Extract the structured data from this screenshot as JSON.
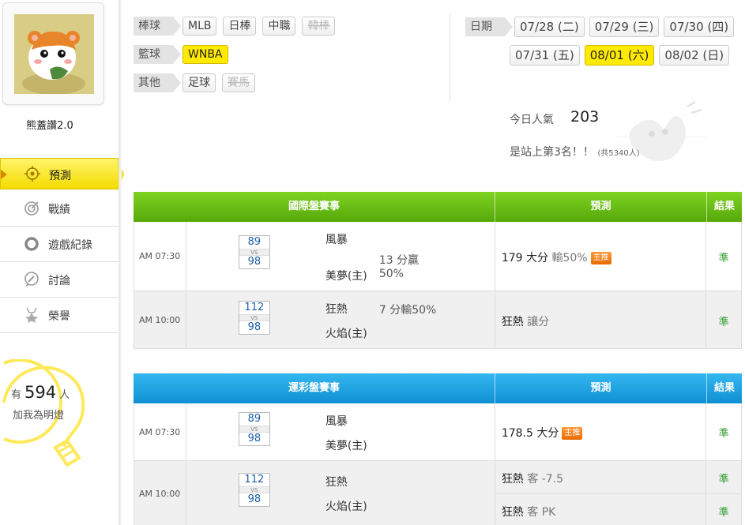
{
  "sidebar": {
    "username": "熊蓋讚2.0",
    "nav": [
      {
        "label": "預測",
        "icon": "target-icon",
        "active": true
      },
      {
        "label": "戰績",
        "icon": "record-icon",
        "active": false
      },
      {
        "label": "遊戲紀錄",
        "icon": "ring-icon",
        "active": false
      },
      {
        "label": "討論",
        "icon": "chat-icon",
        "active": false
      },
      {
        "label": "榮譽",
        "icon": "medal-icon",
        "active": false
      }
    ],
    "fans": {
      "prefix": "有",
      "count": "594",
      "suffix": "人",
      "line2": "加我為明燈"
    }
  },
  "filters": {
    "baseball": {
      "label": "棒球",
      "tags": [
        "MLB",
        "日棒",
        "中職",
        "韓棒"
      ]
    },
    "basketball": {
      "label": "籃球",
      "tags": [
        "WNBA"
      ]
    },
    "other": {
      "label": "其他",
      "tags": [
        "足球",
        "賽馬"
      ]
    },
    "dates": {
      "label": "日期",
      "row1": [
        "07/28 (二)",
        "07/29 (三)",
        "07/30 (四)"
      ],
      "row2": [
        "07/31 (五)",
        "08/01 (六)",
        "08/02 (日)"
      ]
    }
  },
  "popularity": {
    "label": "今日人氣",
    "value": "203",
    "rank": "是站上第3名！！",
    "total": "(共5340人)"
  },
  "intl": {
    "headers": [
      "國際盤賽事",
      "預測",
      "結果"
    ],
    "rows": [
      {
        "time": "AM 07:30",
        "away_score": "89",
        "home_score": "98",
        "away": "風暴",
        "home": "美夢(主)",
        "note1": "13 分贏",
        "note2": "50%",
        "pred": "179 大分",
        "pred_sub": "輸50%",
        "badge": "主推",
        "result": "準"
      },
      {
        "time": "AM 10:00",
        "away_score": "112",
        "home_score": "98",
        "away": "狂熱",
        "home": "火焰(主)",
        "note1": "7 分輸50%",
        "pred": "狂熱",
        "pred_sub": "讓分",
        "result": "準"
      }
    ]
  },
  "lottery": {
    "headers": [
      "運彩盤賽事",
      "預測",
      "結果"
    ],
    "rows": [
      {
        "time": "AM 07:30",
        "away_score": "89",
        "home_score": "98",
        "away": "風暴",
        "home": "美夢(主)",
        "pred": "178.5 大分",
        "badge": "主推",
        "result": "準"
      },
      {
        "time": "AM 10:00",
        "away_score": "112",
        "home_score": "98",
        "away": "狂熱",
        "home": "火焰(主)",
        "pred1": "狂熱",
        "pred1_sub": "客 -7.5",
        "result1": "準",
        "pred2": "狂熱",
        "pred2_sub": "客 PK",
        "result2": "準"
      }
    ]
  },
  "vs_label": "VS"
}
